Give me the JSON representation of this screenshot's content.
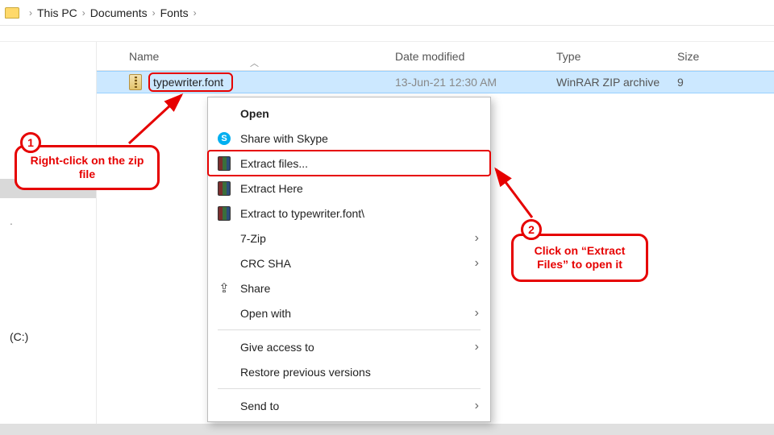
{
  "breadcrumb": {
    "items": [
      "This PC",
      "Documents",
      "Fonts"
    ]
  },
  "columns": {
    "name": "Name",
    "date": "Date modified",
    "type": "Type",
    "size": "Size"
  },
  "file": {
    "name": "typewriter.font",
    "date": "13-Jun-21 12:30 AM",
    "type": "WinRAR ZIP archive",
    "size": "9"
  },
  "sidebar": {
    "drive": "(C:)"
  },
  "menu": {
    "open": "Open",
    "skype": "Share with Skype",
    "extract_files": "Extract files...",
    "extract_here": "Extract Here",
    "extract_to": "Extract to typewriter.font\\",
    "seven_zip": "7-Zip",
    "crc": "CRC SHA",
    "share": "Share",
    "open_with": "Open with",
    "give_access": "Give access to",
    "restore": "Restore previous versions",
    "send_to": "Send to"
  },
  "callouts": {
    "one_num": "1",
    "one_text": "Right-click on the zip file",
    "two_num": "2",
    "two_text": "Click on “Extract Files” to open it"
  }
}
